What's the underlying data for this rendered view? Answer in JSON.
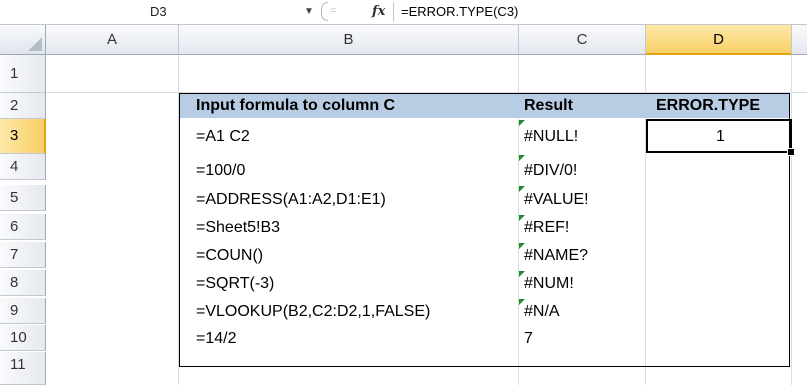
{
  "formula_bar": {
    "name_box": "D3",
    "fx_label": "fx",
    "content": "=ERROR.TYPE(C3)"
  },
  "columns": [
    {
      "label": ""
    },
    {
      "label": "A"
    },
    {
      "label": "B"
    },
    {
      "label": "C"
    },
    {
      "label": "D"
    }
  ],
  "rows": [
    "1",
    "2",
    "3",
    "4",
    "5",
    "6",
    "7",
    "8",
    "9",
    "10",
    "11"
  ],
  "selected": {
    "cell": "D3",
    "column": "D",
    "row": "3"
  },
  "table": {
    "header": {
      "formula": "Input formula to column C",
      "result": "Result",
      "errortype": "ERROR.TYPE"
    },
    "rows": [
      {
        "formula": "=A1 C2",
        "result": "#NULL!",
        "errortype": "1"
      },
      {
        "formula": "=100/0",
        "result": "#DIV/0!",
        "errortype": ""
      },
      {
        "formula": "=ADDRESS(A1:A2,D1:E1)",
        "result": "#VALUE!",
        "errortype": ""
      },
      {
        "formula": "=Sheet5!B3",
        "result": "#REF!",
        "errortype": ""
      },
      {
        "formula": "=COUN()",
        "result": "#NAME?",
        "errortype": ""
      },
      {
        "formula": "=SQRT(-3)",
        "result": "#NUM!",
        "errortype": ""
      },
      {
        "formula": "=VLOOKUP(B2,C2:D2,1,FALSE)",
        "result": "#N/A",
        "errortype": ""
      },
      {
        "formula": "=14/2",
        "result": "7",
        "errortype": ""
      }
    ]
  },
  "colors": {
    "header_fill": "#b8cce4",
    "selection": "#f9cf66",
    "error_indicator": "#1d8a2c"
  }
}
